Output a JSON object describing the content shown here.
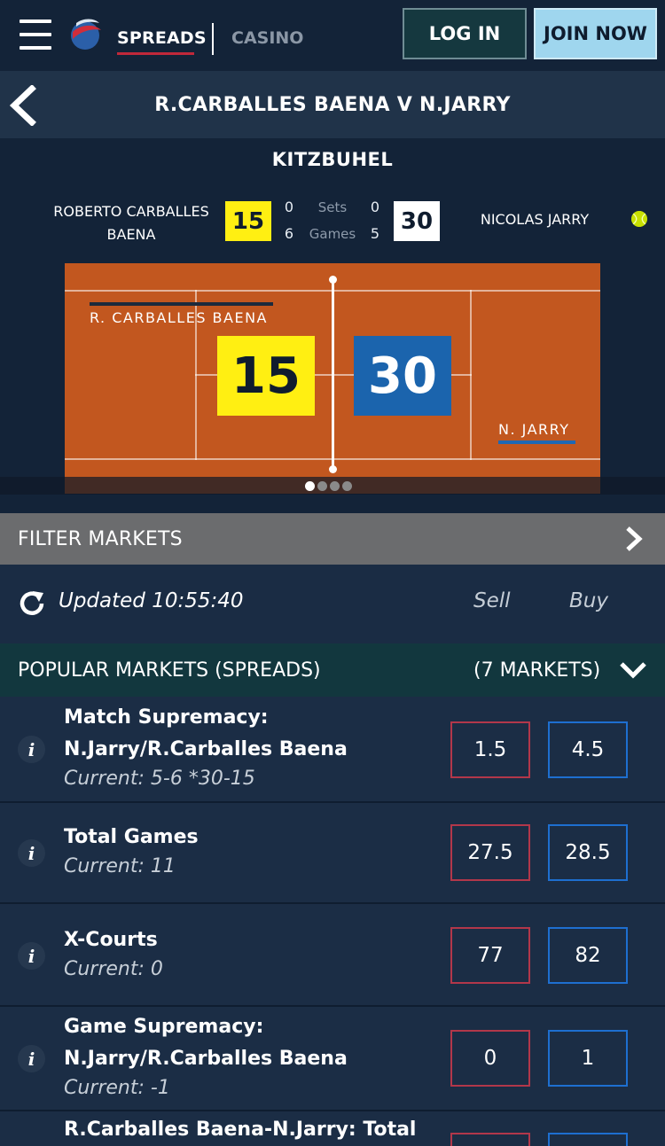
{
  "header": {
    "nav_spreads": "SPREADS",
    "nav_casino": "CASINO",
    "login_label": "LOG IN",
    "join_label": "JOIN NOW"
  },
  "event": {
    "title": "R.CARBALLES BAENA V N.JARRY",
    "tournament": "KITZBUHEL"
  },
  "scoreboard": {
    "player1_name_line1": "ROBERTO CARBALLES",
    "player1_name_line2": "BAENA",
    "player2_name": "NICOLAS JARRY",
    "player1_points": "15",
    "player2_points": "30",
    "sets_label": "Sets",
    "games_label": "Games",
    "player1_sets": "0",
    "player2_sets": "0",
    "player1_games": "6",
    "player2_games": "5",
    "serving_icon": "tennis-ball-icon"
  },
  "court": {
    "player1_label": "R. CARBALLES BAENA",
    "player2_label": "N. JARRY",
    "player1_score": "15",
    "player2_score": "30"
  },
  "carousel": {
    "total": 4,
    "active_index": 0
  },
  "filter": {
    "label": "FILTER MARKETS"
  },
  "updated": {
    "text": "Updated 10:55:40",
    "sell_label": "Sell",
    "buy_label": "Buy"
  },
  "popular": {
    "label": "POPULAR MARKETS (SPREADS)",
    "count": "(7 MARKETS)"
  },
  "markets": [
    {
      "title_line1": "Match Supremacy:",
      "title_line2": "N.Jarry/R.Carballes Baena",
      "current": "Current: 5-6 *30-15",
      "sell": "1.5",
      "buy": "4.5"
    },
    {
      "title_line1": "Total Games",
      "title_line2": "",
      "current": "Current: 11",
      "sell": "27.5",
      "buy": "28.5"
    },
    {
      "title_line1": "X-Courts",
      "title_line2": "",
      "current": "Current: 0",
      "sell": "77",
      "buy": "82"
    },
    {
      "title_line1": "Game Supremacy:",
      "title_line2": "N.Jarry/R.Carballes Baena",
      "current": "Current: -1",
      "sell": "0",
      "buy": "1"
    },
    {
      "title_line1": "R.Carballes Baena-N.Jarry: Total",
      "title_line2": "",
      "current": "",
      "sell": "",
      "buy": ""
    }
  ],
  "colors": {
    "background": "#132338",
    "accent_red": "#c0283a",
    "sell_border": "#b2374a",
    "buy_border": "#1e6fd0",
    "court": "#c2571f",
    "player1_score": "#ffef12",
    "player2_score": "#1b64ad",
    "join_button": "#9fd6ee"
  }
}
